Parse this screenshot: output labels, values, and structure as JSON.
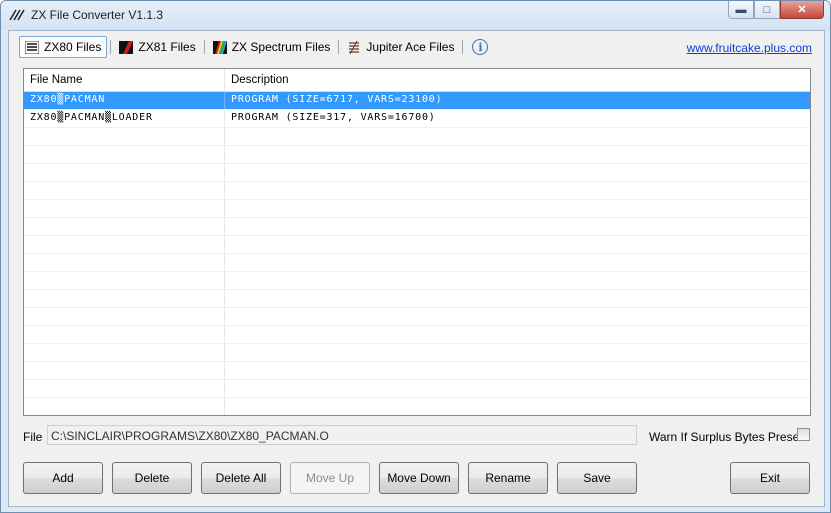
{
  "window": {
    "title": "ZX File Converter V1.1.3",
    "controls": {
      "minimize": "▬",
      "maximize": "□",
      "close": "✕"
    }
  },
  "toolbar": {
    "tabs": [
      {
        "label": "ZX80 Files",
        "icon": "zx80-icon",
        "active": true
      },
      {
        "label": "ZX81 Files",
        "icon": "zx81-icon",
        "active": false
      },
      {
        "label": "ZX Spectrum Files",
        "icon": "zx-spectrum-icon",
        "active": false
      },
      {
        "label": "Jupiter Ace Files",
        "icon": "jupiter-ace-icon",
        "active": false
      }
    ],
    "info_glyph": "i",
    "link": "www.fruitcake.plus.com"
  },
  "table": {
    "columns": [
      "File Name",
      "Description"
    ],
    "rows": [
      {
        "name": "ZX80▒PACMAN",
        "description": "PROGRAM (SIZE=6717, VARS=23100)",
        "selected": true
      },
      {
        "name": "ZX80▒PACMAN▒LOADER",
        "description": "PROGRAM (SIZE=317, VARS=16700)",
        "selected": false
      }
    ]
  },
  "file": {
    "label": "File",
    "value": "C:\\SINCLAIR\\PROGRAMS\\ZX80\\ZX80_PACMAN.O"
  },
  "warn": {
    "label": "Warn If Surplus Bytes Present",
    "checked": false
  },
  "buttons": {
    "add": "Add",
    "delete": "Delete",
    "delete_all": "Delete All",
    "move_up": "Move Up",
    "move_down": "Move Down",
    "rename": "Rename",
    "save": "Save",
    "exit": "Exit"
  },
  "colors": {
    "selection": "#3399ff",
    "link": "#0b3fd3",
    "accent": "#3d6fb5"
  }
}
